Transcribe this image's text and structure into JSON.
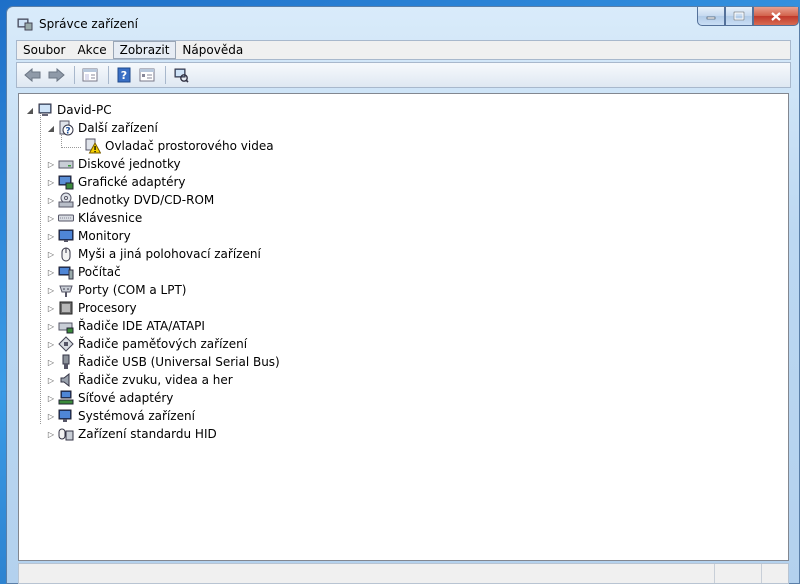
{
  "window": {
    "title": "Správce zařízení"
  },
  "menu": [
    "Soubor",
    "Akce",
    "Zobrazit",
    "Nápověda"
  ],
  "toolbar": [
    "back-icon",
    "forward-icon",
    "show-hide-tree-icon",
    "help-icon",
    "properties-icon",
    "scan-hardware-icon"
  ],
  "tree": {
    "root": "David-PC",
    "expanded_category": "Další zařízení",
    "expanded_child": "Ovladač prostorového videa",
    "categories": [
      "Diskové jednotky",
      "Grafické adaptéry",
      "Jednotky DVD/CD-ROM",
      "Klávesnice",
      "Monitory",
      "Myši a jiná polohovací zařízení",
      "Počítač",
      "Porty (COM a LPT)",
      "Procesory",
      "Řadiče IDE ATA/ATAPI",
      "Řadiče paměťových zařízení",
      "Řadiče USB (Universal Serial Bus)",
      "Řadiče zvuku, videa a her",
      "Síťové adaptéry",
      "Systémová zařízení",
      "Zařízení standardu HID"
    ]
  }
}
